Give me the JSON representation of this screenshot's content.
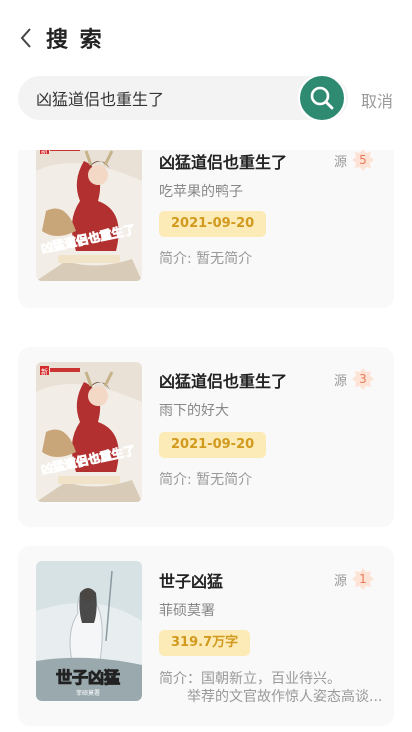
{
  "header": {
    "title": "搜 索"
  },
  "search": {
    "value": "凶猛道侣也重生了",
    "cancel_label": "取消"
  },
  "results": [
    {
      "title": "凶猛道侣也重生了",
      "source_label": "源",
      "source_count": "5",
      "author": "吃苹果的鸭子",
      "tag": "2021-09-20",
      "intro": "简介: 暂无简介",
      "intro_line2": ""
    },
    {
      "title": "凶猛道侣也重生了",
      "source_label": "源",
      "source_count": "3",
      "author": "雨下的好大",
      "tag": "2021-09-20",
      "intro": "简介: 暂无简介",
      "intro_line2": ""
    },
    {
      "title": "世子凶猛",
      "source_label": "源",
      "source_count": "1",
      "author": "菲硕莫署",
      "tag": "319.7万字",
      "intro": "简介：国朝新立，百业待兴。",
      "intro_line2": "举荐的文官故作惊人姿态高谈..."
    }
  ],
  "covers": {
    "1": {
      "text": "凶猛道侣也重生了",
      "brand": "新"
    },
    "2": {
      "text": "凶猛道侣也重生了",
      "brand": "新"
    },
    "3": {
      "text": "世子凶猛",
      "author": "菲硕莫署"
    }
  },
  "colors": {
    "accent": "#2f8a72",
    "tag_bg": "#fcebb6",
    "tag_text": "#d19a1e",
    "badge": "#e87b5b"
  }
}
